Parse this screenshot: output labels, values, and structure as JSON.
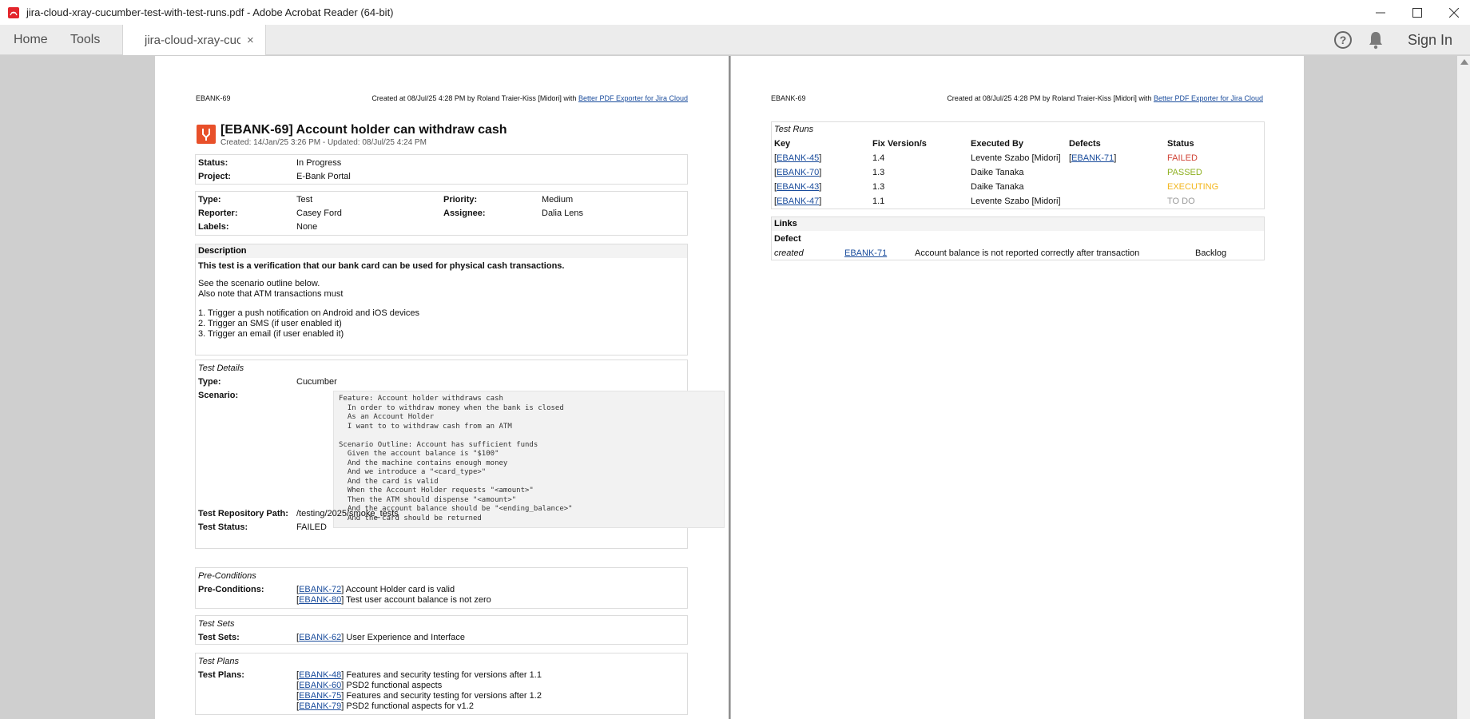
{
  "window": {
    "title": "jira-cloud-xray-cucumber-test-with-test-runs.pdf - Adobe Acrobat Reader (64-bit)"
  },
  "toolbar": {
    "home": "Home",
    "tools": "Tools",
    "tab_label": "jira-cloud-xray-cuc...",
    "tab_close": "×",
    "help": "?",
    "sign_in": "Sign In"
  },
  "page_header": {
    "key": "EBANK-69",
    "created_text": "Created at 08/Jul/25 4:28 PM by Roland Traier-Kiss [Midori] with ",
    "exporter_link": "Better PDF Exporter for Jira Cloud"
  },
  "issue": {
    "title": "[EBANK-69] Account holder can withdraw cash",
    "meta": "Created: 14/Jan/25 3:26 PM - Updated: 08/Jul/25 4:24 PM",
    "status_label": "Status:",
    "status_value": "In Progress",
    "project_label": "Project:",
    "project_value": "E-Bank Portal",
    "type_label": "Type:",
    "type_value": "Test",
    "priority_label": "Priority:",
    "priority_value": "Medium",
    "reporter_label": "Reporter:",
    "reporter_value": "Casey Ford",
    "assignee_label": "Assignee:",
    "assignee_value": "Dalia Lens",
    "labels_label": "Labels:",
    "labels_value": "None"
  },
  "description": {
    "heading": "Description",
    "line1": "This test is a verification that our bank card can be used for physical cash transactions.",
    "line2": "See the scenario outline below.",
    "line3": "Also note that ATM transactions must",
    "items": [
      "1.  Trigger a push notification on Android and iOS devices",
      "2.  Trigger an SMS (if user enabled it)",
      "3.  Trigger an email (if user enabled it)"
    ]
  },
  "test_details": {
    "heading": "Test Details",
    "type_label": "Type:",
    "type_value": "Cucumber",
    "scenario_label": "Scenario:",
    "scenario": "Feature: Account holder withdraws cash\n  In order to withdraw money when the bank is closed\n  As an Account Holder\n  I want to to withdraw cash from an ATM\n\nScenario Outline: Account has sufficient funds\n  Given the account balance is \"$100\"\n  And the machine contains enough money\n  And we introduce a \"<card_type>\"\n  And the card is valid\n  When the Account Holder requests \"<amount>\"\n  Then the ATM should dispense \"<amount>\"\n  And the account balance should be \"<ending_balance>\"\n  And the card should be returned",
    "repo_label": "Test Repository Path:",
    "repo_value": "/testing/2025/smoke_tests",
    "test_status_label": "Test Status:",
    "test_status_value": "FAILED"
  },
  "preconditions": {
    "heading": "Pre-Conditions",
    "label": "Pre-Conditions:",
    "items": [
      {
        "key": "EBANK-72",
        "text": " Account Holder card is valid"
      },
      {
        "key": "EBANK-80",
        "text": " Test user account balance is not zero"
      }
    ]
  },
  "test_sets": {
    "heading": "Test Sets",
    "label": "Test Sets:",
    "items": [
      {
        "key": "EBANK-62",
        "text": " User Experience and Interface"
      }
    ]
  },
  "test_plans": {
    "heading": "Test Plans",
    "label": "Test Plans:",
    "items": [
      {
        "key": "EBANK-48",
        "text": " Features and security testing for versions after 1.1"
      },
      {
        "key": "EBANK-60",
        "text": " PSD2 functional aspects"
      },
      {
        "key": "EBANK-75",
        "text": " Features and security testing for versions after 1.2"
      },
      {
        "key": "EBANK-79",
        "text": " PSD2 functional aspects for v1.2"
      }
    ]
  },
  "test_runs": {
    "heading": "Test Runs",
    "columns": [
      "Key",
      "Fix Version/s",
      "Executed By",
      "Defects",
      "Status"
    ],
    "rows": [
      {
        "key": "EBANK-45",
        "version": "1.4",
        "executed_by": "Levente Szabo [Midori]",
        "defect": "EBANK-71",
        "status": "FAILED",
        "status_color": "#d04437"
      },
      {
        "key": "EBANK-70",
        "version": "1.3",
        "executed_by": "Daike Tanaka",
        "defect": "",
        "status": "PASSED",
        "status_color": "#8eb021"
      },
      {
        "key": "EBANK-43",
        "version": "1.3",
        "executed_by": "Daike Tanaka",
        "defect": "",
        "status": "EXECUTING",
        "status_color": "#f3b61b"
      },
      {
        "key": "EBANK-47",
        "version": "1.1",
        "executed_by": "Levente Szabo [Midori]",
        "defect": "",
        "status": "TO DO",
        "status_color": "#999999"
      }
    ]
  },
  "links": {
    "heading": "Links",
    "sub_heading": "Defect",
    "relation": "created",
    "key": "EBANK-71",
    "summary": "Account balance is not reported correctly after transaction",
    "status": "Backlog"
  }
}
